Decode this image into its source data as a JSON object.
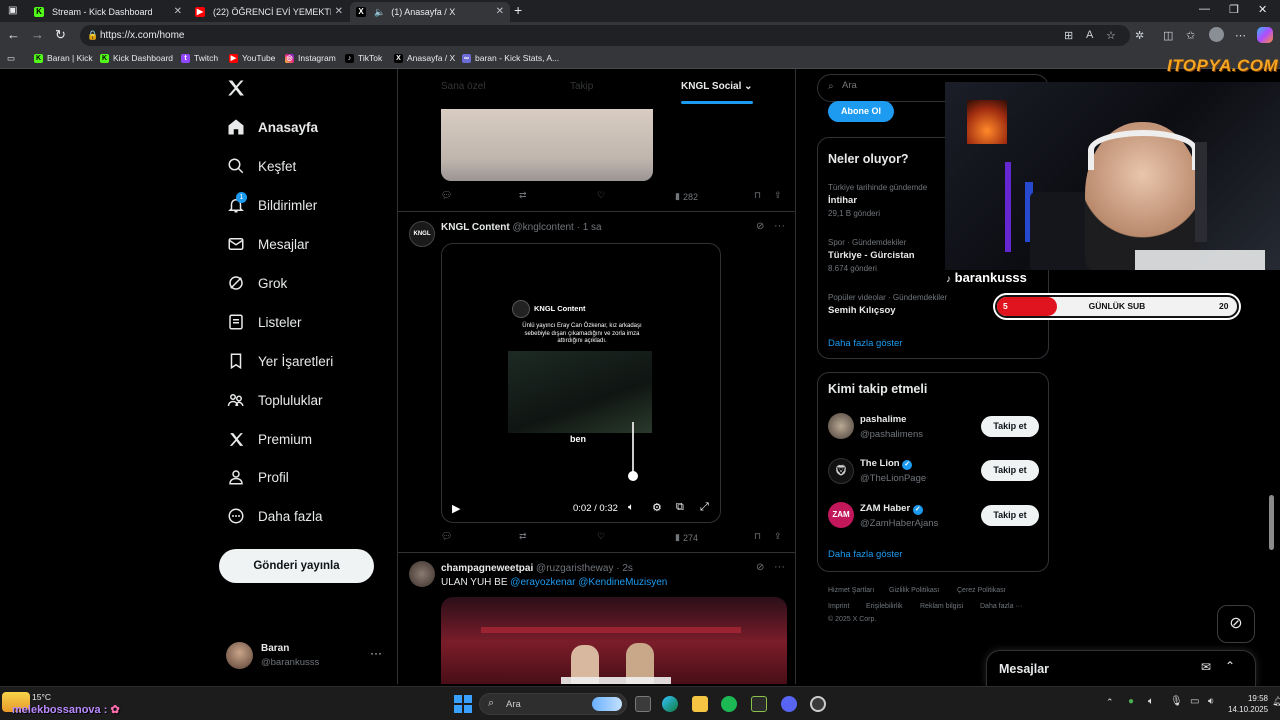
{
  "browser": {
    "tabs": [
      {
        "label": "Stream - Kick Dashboard"
      },
      {
        "label": "(22) ÖĞRENCİ EVİ YEMEKTEYİZ 1..."
      },
      {
        "label": "(1) Anasayfa / X"
      }
    ],
    "url": "https://x.com/home",
    "bookmarks": [
      "Baran | Kick",
      "Kick Dashboard",
      "Twitch",
      "YouTube",
      "Instagram",
      "TikTok",
      "Anasayfa / X",
      "baran - Kick Stats, A..."
    ]
  },
  "nav": {
    "items": [
      {
        "label": "Anasayfa"
      },
      {
        "label": "Keşfet"
      },
      {
        "label": "Bildirimler",
        "badge": "1"
      },
      {
        "label": "Mesajlar"
      },
      {
        "label": "Grok"
      },
      {
        "label": "Listeler"
      },
      {
        "label": "Yer İşaretleri"
      },
      {
        "label": "Topluluklar"
      },
      {
        "label": "Premium"
      },
      {
        "label": "Profil"
      },
      {
        "label": "Daha fazla"
      }
    ],
    "post_button": "Gönderi yayınla",
    "account": {
      "name": "Baran",
      "handle": "@barankusss"
    }
  },
  "feed": {
    "tabs": [
      "Sana özel",
      "Takip",
      "KNGL Social"
    ],
    "post0": {
      "views": "282"
    },
    "post1": {
      "author": "KNGL Content",
      "handle": "@knglcontent",
      "time": "1 sa",
      "video": {
        "inner_author": "KNGL Content",
        "inner_text": "Ünlü yayıncı Eray Can Özkenar, kız arkadaşı sebebiyle dışarı çıkamadığını ve zorla imza attırdığını açıkladı.",
        "caption": "ben",
        "time": "0:02 / 0:32"
      },
      "views": "274"
    },
    "post2": {
      "author": "champagneweetpai",
      "handle": "@ruzgaristheway",
      "time": "2s",
      "text_prefix": "ULAN YUH BE ",
      "mention1": "@erayozkenar",
      "mention2": "@KendineMuzisyen"
    }
  },
  "right": {
    "search_placeholder": "Ara",
    "subscribe": "Abone Ol",
    "trends": {
      "title": "Neler oluyor?",
      "items": [
        {
          "meta": "Türkiye tarihinde gündemde",
          "title": "İntihar",
          "count": "29,1 B gönderi"
        },
        {
          "meta": "Spor · Gündemdekiler",
          "title": "Türkiye - Gürcistan",
          "count": "8.674 gönderi"
        },
        {
          "meta": "Popüler videolar · Gündemdekiler",
          "title": "Semih Kılıçsoy",
          "count": ""
        }
      ],
      "more": "Daha fazla göster"
    },
    "who": {
      "title": "Kimi takip etmeli",
      "items": [
        {
          "name": "pashalime",
          "handle": "@pashalimens",
          "verified": false,
          "btn": "Takip et"
        },
        {
          "name": "The Lion",
          "handle": "@TheLionPage",
          "verified": true,
          "btn": "Takip et"
        },
        {
          "name": "ZAM Haber",
          "handle": "@ZamHaberAjans",
          "verified": true,
          "btn": "Takip et"
        }
      ],
      "more": "Daha fazla göster"
    },
    "footer": [
      "Hizmet Şartları",
      "Gizlilik Politikası",
      "Çerez Politikası",
      "Imprint",
      "Erişilebilirlik",
      "Reklam bilgisi",
      "Daha fazla ···",
      "© 2025 X Corp."
    ],
    "messages": "Mesajlar"
  },
  "overlay": {
    "watermark": "ITOPYA.COM",
    "streamer": "barankusss",
    "bar": {
      "left": "5",
      "label": "GÜNLÜK SUB",
      "right": "20",
      "progress": 0.25
    }
  },
  "taskbar": {
    "weather": "15°C",
    "chat": "melekbossanova :",
    "search": "Ara",
    "time": "19:58",
    "date": "14.10.2025"
  },
  "colors": {
    "accent": "#1d9bf0",
    "bg": "#000000",
    "bar_red": "#e0141e"
  }
}
